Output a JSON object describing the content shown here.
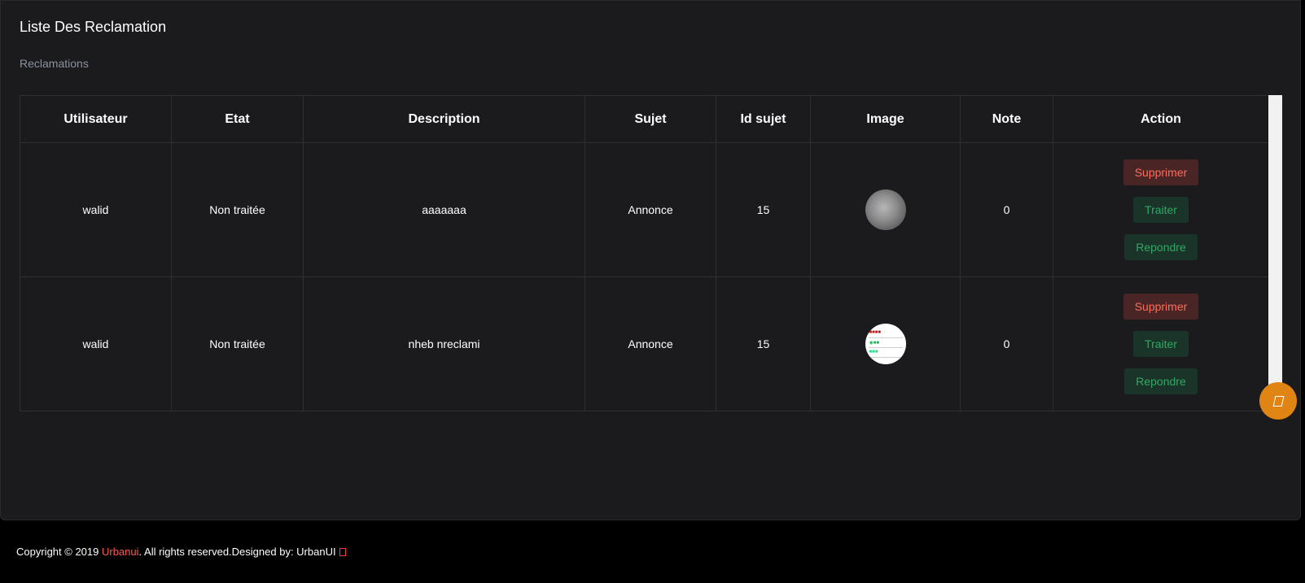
{
  "card": {
    "title": "Liste Des Reclamation",
    "subtitle": "Reclamations"
  },
  "table": {
    "headers": [
      "Utilisateur",
      "Etat",
      "Description",
      "Sujet",
      "Id sujet",
      "Image",
      "Note",
      "Action"
    ],
    "rows": [
      {
        "utilisateur": "walid",
        "etat": "Non traitée",
        "description": "aaaaaaa",
        "sujet": "Annonce",
        "id_sujet": "15",
        "image": "ball-thumbnail",
        "note": "0"
      },
      {
        "utilisateur": "walid",
        "etat": "Non traitée",
        "description": "nheb nreclami",
        "sujet": "Annonce",
        "id_sujet": "15",
        "image": "streaming-list-thumbnail",
        "note": "0"
      }
    ],
    "actions": {
      "delete": "Supprimer",
      "process": "Traiter",
      "reply": "Repondre"
    }
  },
  "footer": {
    "prefix": "Copyright © 2019 ",
    "brand": "Urbanui",
    "suffix": ". All rights reserved.Designed by: UrbanUI"
  },
  "colors": {
    "card_bg": "#1b1b1e",
    "page_bg": "#000000",
    "danger": "#ff6b5b",
    "success": "#2fa864",
    "fab": "#e08514",
    "brand": "#ff5a4f"
  },
  "icons": {
    "fab": "settings-icon",
    "footer": "heart-icon"
  }
}
